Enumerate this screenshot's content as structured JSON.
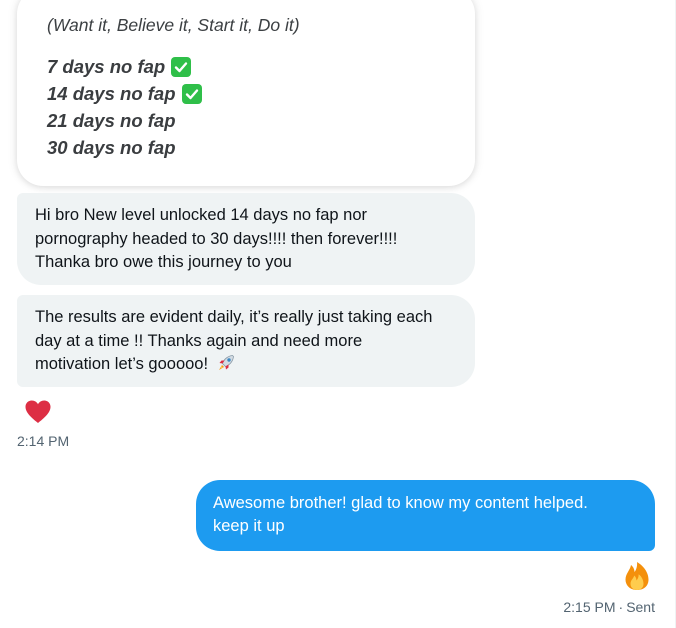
{
  "card": {
    "quote": "(Want it, Believe it, Start it, Do it)",
    "lines": [
      {
        "text": "7 days no fap",
        "checked": true
      },
      {
        "text": "14 days no fap",
        "checked": true
      },
      {
        "text": "21 days no fap",
        "checked": false
      },
      {
        "text": "30 days no fap",
        "checked": false
      }
    ]
  },
  "messages_in": [
    {
      "text_lines": [
        "Hi bro New level unlocked 14 days no fap nor",
        "pornography headed to 30 days!!!! then forever!!!!",
        "Thanka bro owe this journey to you"
      ]
    },
    {
      "text_lines": [
        "The results are evident daily, it’s really just taking each",
        "day at a time !! Thanks again and need more",
        "motivation let’s gooooo!"
      ],
      "trailing_icon": "rocket-icon"
    }
  ],
  "reaction_in": "heart-icon",
  "time_in": "2:14 PM",
  "message_out": {
    "text_lines": [
      "Awesome brother! glad to know my content helped.",
      "keep it up"
    ]
  },
  "reaction_out": "fire-icon",
  "time_out": "2:15 PM",
  "separator": "·",
  "status_out": "Sent",
  "colors": {
    "sent_bubble": "#1d9bf0",
    "received_bubble": "#eff3f4",
    "meta_text": "#536471",
    "check": "#2fbf49",
    "heart": "#e0245e"
  }
}
